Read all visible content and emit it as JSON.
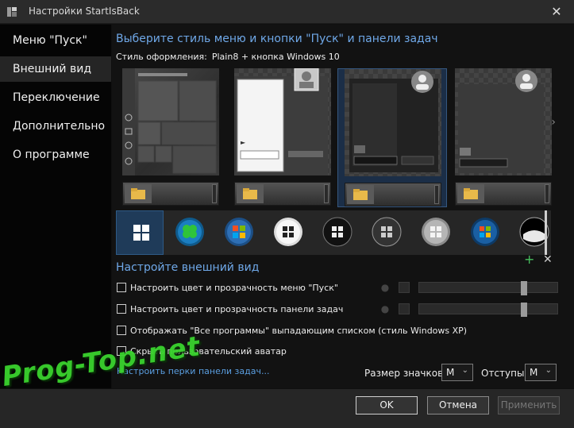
{
  "window": {
    "title": "Настройки StartIsBack",
    "close_glyph": "✕"
  },
  "sidebar": {
    "items": [
      {
        "label": "Меню \"Пуск\""
      },
      {
        "label": "Внешний вид"
      },
      {
        "label": "Переключение"
      },
      {
        "label": "Дополнительно"
      },
      {
        "label": "О программе"
      }
    ],
    "active_index": 1
  },
  "style_section": {
    "heading": "Выберите стиль меню и кнопки \"Пуск\" и панели задач",
    "style_label": "Стиль оформления:",
    "style_value": "Plain8 + кнопка Windows 10",
    "selected_preview_index": 2,
    "selected_orb_index": 0
  },
  "appearance": {
    "heading": "Настройте внешний вид",
    "options": [
      {
        "label": "Настроить цвет и прозрачность меню \"Пуск\"",
        "checked": false
      },
      {
        "label": "Настроить цвет и прозрачность панели задач",
        "checked": false
      },
      {
        "label": "Отображать \"Все программы\" выпадающим списком (стиль Windows XP)",
        "checked": false
      },
      {
        "label": "Скрыть пользовательский аватар",
        "checked": false
      }
    ],
    "sliders": [
      {
        "value": 0.75
      },
      {
        "value": 0.75
      }
    ],
    "add_glyph": "+",
    "remove_glyph": "✕",
    "link": "Настроить перки панели задач...",
    "icon_size_label": "Размер значков:",
    "icon_size_value": "M",
    "indent_label": "Отступы:",
    "indent_value": "M"
  },
  "footer": {
    "ok": "OK",
    "cancel": "Отмена",
    "apply": "Применить"
  },
  "watermark": "Prog-Top.net",
  "colors": {
    "accent": "#6fa8e8",
    "link": "#5a9ee0",
    "selection": "#1f3b59",
    "add_green": "#47c05d",
    "watermark_green": "#3ad32e"
  }
}
